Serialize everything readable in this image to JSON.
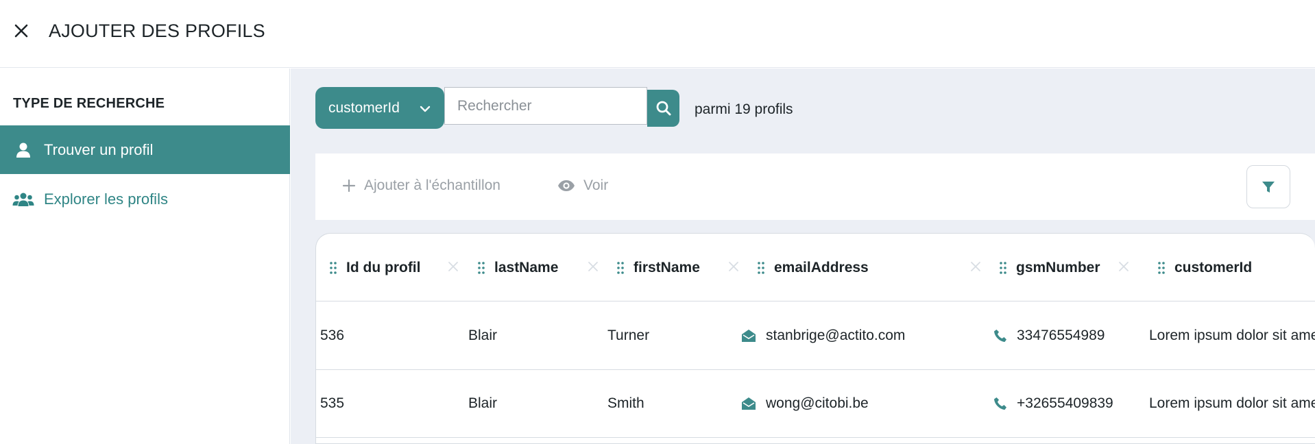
{
  "header": {
    "title": "AJOUTER DES PROFILS",
    "close_icon": "close-icon"
  },
  "sidebar": {
    "heading": "TYPE DE RECHERCHE",
    "items": [
      {
        "label": "Trouver un profil",
        "icon": "user-icon",
        "active": true
      },
      {
        "label": "Explorer les profils",
        "icon": "users-group-icon",
        "active": false
      }
    ]
  },
  "search": {
    "field_selected": "customerId",
    "placeholder": "Rechercher",
    "value": "",
    "count_text": "parmi 19 profils"
  },
  "toolbar": {
    "add_label": "Ajouter à l'échantillon",
    "view_label": "Voir",
    "filter_icon": "filter-icon"
  },
  "table": {
    "columns": [
      "Id du profil",
      "lastName",
      "firstName",
      "emailAddress",
      "gsmNumber",
      "customerId"
    ],
    "rows": [
      {
        "id": "536",
        "lastName": "Blair",
        "firstName": "Turner",
        "email": "stanbrige@actito.com",
        "gsm": "33476554989",
        "customerId": "Lorem ipsum dolor sit amet"
      },
      {
        "id": "535",
        "lastName": "Blair",
        "firstName": "Smith",
        "email": "wong@citobi.be",
        "gsm": "+32655409839",
        "customerId": "Lorem ipsum dolor sit amet"
      }
    ]
  },
  "colors": {
    "accent": "#3d8b8b",
    "background": "#eceff5",
    "muted": "#9aa0a6"
  }
}
